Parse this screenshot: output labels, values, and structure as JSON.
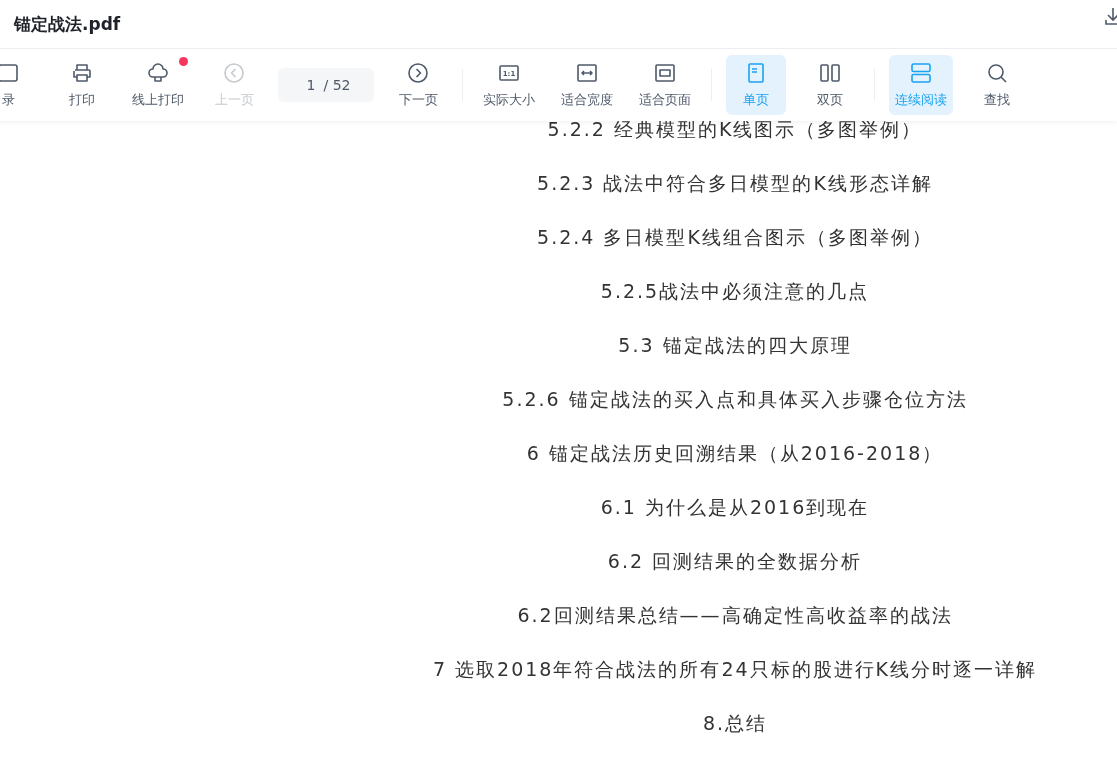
{
  "window": {
    "title": "锚定战法.pdf"
  },
  "toolbar": {
    "items": [
      {
        "kind": "outline",
        "label": "录",
        "selected": false,
        "disabled": false,
        "badge": false
      },
      {
        "kind": "print",
        "label": "打印",
        "selected": false,
        "disabled": false,
        "badge": false
      },
      {
        "kind": "cloud-print",
        "label": "线上打印",
        "selected": false,
        "disabled": false,
        "badge": true
      },
      {
        "kind": "prev",
        "label": "上一页",
        "selected": false,
        "disabled": true,
        "badge": false
      },
      {
        "kind": "page",
        "current": "1",
        "total": "/ 52"
      },
      {
        "kind": "next",
        "label": "下一页",
        "selected": false,
        "disabled": false,
        "badge": false
      },
      {
        "kind": "divider"
      },
      {
        "kind": "actual-size",
        "icon_text": "1:1",
        "label": "实际大小",
        "selected": false,
        "disabled": false,
        "badge": false
      },
      {
        "kind": "fit-width",
        "label": "适合宽度",
        "selected": false,
        "disabled": false,
        "badge": false
      },
      {
        "kind": "fit-page",
        "label": "适合页面",
        "selected": false,
        "disabled": false,
        "badge": false
      },
      {
        "kind": "divider"
      },
      {
        "kind": "single",
        "label": "单页",
        "selected": true,
        "disabled": false,
        "badge": false
      },
      {
        "kind": "double",
        "label": "双页",
        "selected": false,
        "disabled": false,
        "badge": false
      },
      {
        "kind": "divider"
      },
      {
        "kind": "continuous",
        "label": "连续阅读",
        "selected": true,
        "disabled": false,
        "badge": false
      },
      {
        "kind": "search",
        "label": "查找",
        "selected": false,
        "disabled": false,
        "badge": false
      }
    ]
  },
  "document": {
    "lines": [
      "5.2.2 经典模型的K线图示（多图举例）",
      "5.2.3 战法中符合多日模型的K线形态详解",
      "5.2.4 多日模型K线组合图示（多图举例）",
      "5.2.5战法中必须注意的几点",
      "5.3 锚定战法的四大原理",
      "5.2.6 锚定战法的买入点和具体买入步骤仓位方法",
      "6 锚定战法历史回溯结果（从2016-2018）",
      "6.1 为什么是从2016到现在",
      "6.2 回测结果的全数据分析",
      "6.2回测结果总结——高确定性高收益率的战法",
      "7 选取2018年符合战法的所有24只标的股进行K线分时逐一详解",
      "8.总结"
    ]
  }
}
